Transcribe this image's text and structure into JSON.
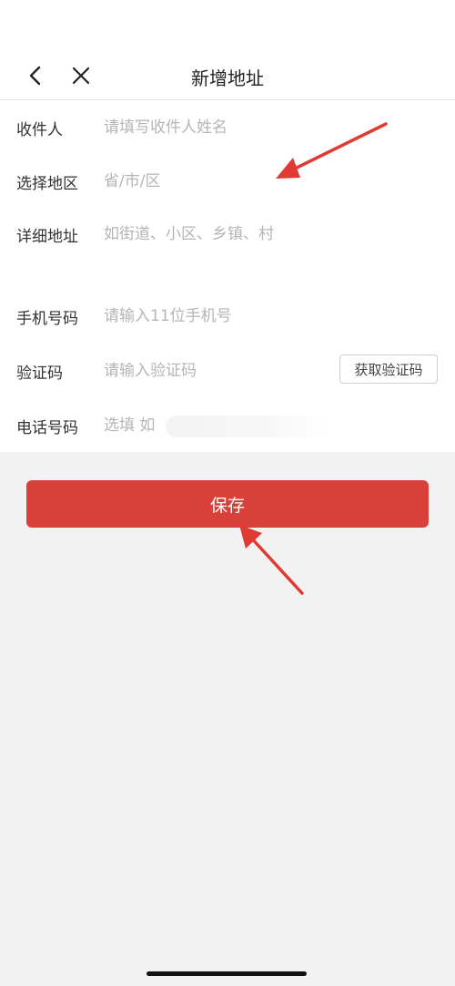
{
  "header": {
    "title": "新增地址"
  },
  "form": {
    "receiver": {
      "label": "收件人",
      "placeholder": "请填写收件人姓名"
    },
    "region": {
      "label": "选择地区",
      "placeholder": "省/市/区"
    },
    "address": {
      "label": "详细地址",
      "placeholder": "如街道、小区、乡镇、村"
    },
    "mobile": {
      "label": "手机号码",
      "placeholder": "请输入11位手机号"
    },
    "code": {
      "label": "验证码",
      "placeholder": "请输入验证码",
      "button": "获取验证码"
    },
    "phone": {
      "label": "电话号码",
      "placeholder": "选填 如"
    }
  },
  "save_label": "保存",
  "colors": {
    "accent": "#d9403a",
    "annotation_arrow": "#e03a35"
  },
  "icons": {
    "back": "chevron-left-icon",
    "close": "close-icon"
  }
}
